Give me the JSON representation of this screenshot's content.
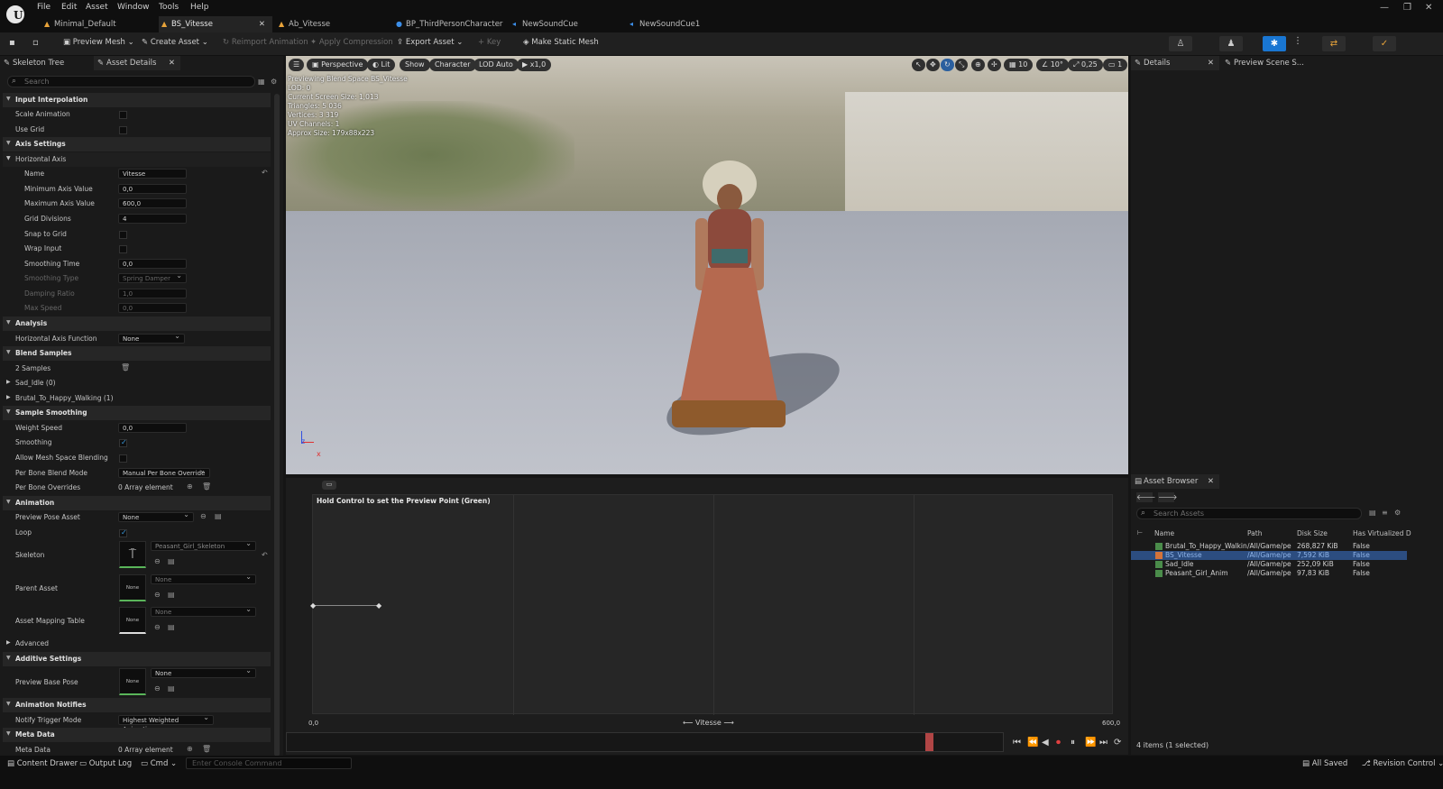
{
  "menu": [
    "File",
    "Edit",
    "Asset",
    "Window",
    "Tools",
    "Help"
  ],
  "tabs": [
    {
      "label": "Minimal_Default",
      "icon": "level-icon",
      "active": false
    },
    {
      "label": "BS_Vitesse",
      "icon": "blendspace-icon",
      "active": true
    },
    {
      "label": "Ab_Vitesse",
      "icon": "anim-icon",
      "active": false
    },
    {
      "label": "BP_ThirdPersonCharacter",
      "icon": "blueprint-icon",
      "active": false
    },
    {
      "label": "NewSoundCue",
      "icon": "sound-icon",
      "active": false
    },
    {
      "label": "NewSoundCue1",
      "icon": "sound-icon",
      "active": false
    }
  ],
  "toolbar": {
    "preview_mesh": "Preview Mesh",
    "create_asset": "Create Asset",
    "reimport": "Reimport Animation",
    "apply_compression": "Apply Compression",
    "export_asset": "Export Asset",
    "key": "Key",
    "make_static_mesh": "Make Static Mesh"
  },
  "left_tabs": {
    "skeleton_tree": "Skeleton Tree",
    "asset_details": "Asset Details"
  },
  "search_placeholder": "Search",
  "details": {
    "input_interpolation": "Input Interpolation",
    "scale_animation": "Scale Animation",
    "use_grid": "Use Grid",
    "axis_settings": "Axis Settings",
    "horizontal_axis": "Horizontal Axis",
    "name_label": "Name",
    "name_value": "Vitesse",
    "min_label": "Minimum Axis Value",
    "min_value": "0,0",
    "max_label": "Maximum Axis Value",
    "max_value": "600,0",
    "grid_div_label": "Grid Divisions",
    "grid_div_value": "4",
    "snap_label": "Snap to Grid",
    "wrap_label": "Wrap Input",
    "smoothing_time_label": "Smoothing Time",
    "smoothing_time_value": "0,0",
    "smoothing_type_label": "Smoothing Type",
    "smoothing_type_value": "Spring Damper",
    "damping_label": "Damping Ratio",
    "damping_value": "1,0",
    "maxspeed_label": "Max Speed",
    "maxspeed_value": "0,0",
    "analysis": "Analysis",
    "haf_label": "Horizontal Axis Function",
    "haf_value": "None",
    "blend_samples": "Blend Samples",
    "samples_count": "2 Samples",
    "sample0": "Sad_Idle (0)",
    "sample1": "Brutal_To_Happy_Walking (1)",
    "sample_smoothing": "Sample Smoothing",
    "weight_speed_label": "Weight Speed",
    "weight_speed_value": "0,0",
    "smoothing_label": "Smoothing",
    "allow_mesh_label": "Allow Mesh Space Blending",
    "per_bone_mode_label": "Per Bone Blend Mode",
    "per_bone_mode_value": "Manual Per Bone Override",
    "per_bone_over_label": "Per Bone Overrides",
    "per_bone_over_value": "0 Array element",
    "animation": "Animation",
    "preview_pose_label": "Preview Pose Asset",
    "preview_pose_value": "None",
    "loop_label": "Loop",
    "skeleton_label": "Skeleton",
    "skeleton_value": "Peasant_Girl_Skeleton",
    "parent_label": "Parent Asset",
    "parent_value": "None",
    "parent_thumb": "None",
    "mapping_label": "Asset Mapping Table",
    "mapping_value": "None",
    "mapping_thumb": "None",
    "advanced": "Advanced",
    "additive": "Additive Settings",
    "base_pose_label": "Preview Base Pose",
    "base_pose_value": "None",
    "base_pose_thumb": "None",
    "notifies": "Animation Notifies",
    "notify_mode_label": "Notify Trigger Mode",
    "notify_mode_value": "Highest Weighted Animation",
    "meta": "Meta Data",
    "meta_label": "Meta Data",
    "meta_value": "0 Array element"
  },
  "viewport": {
    "perspective": "Perspective",
    "lit": "Lit",
    "show": "Show",
    "character": "Character",
    "lod": "LOD Auto",
    "speed": "x1,0",
    "grid": "10",
    "angle": "10°",
    "scale": "0,25",
    "cam": "1",
    "stats": [
      "Previewing Blend Space BS_Vitesse",
      "LOD: 0",
      "Current Screen Size: 1,013",
      "Triangles: 5 036",
      "Vertices: 3 319",
      "UV Channels: 1",
      "Approx Size: 179x88x223"
    ]
  },
  "right_tabs": {
    "details": "Details",
    "preview_scene": "Preview Scene S..."
  },
  "blendspace": {
    "hint": "Hold Control to set the Preview Point (Green)",
    "min": "0,0",
    "max": "600,0",
    "axis": "Vitesse"
  },
  "asset_browser": {
    "title": "Asset Browser",
    "search_placeholder": "Search Assets",
    "columns": [
      "Name",
      "Path",
      "Disk Size",
      "Has Virtualized D"
    ],
    "rows": [
      {
        "name": "Brutal_To_Happy_Walkin",
        "path": "/All/Game/pe",
        "size": "268,827 KiB",
        "virt": "False"
      },
      {
        "name": "BS_Vitesse",
        "path": "/All/Game/pe",
        "size": "7,592 KiB",
        "virt": "False"
      },
      {
        "name": "Sad_Idle",
        "path": "/All/Game/pe",
        "size": "252,09 KiB",
        "virt": "False"
      },
      {
        "name": "Peasant_Girl_Anim",
        "path": "/All/Game/pe",
        "size": "97,83 KiB",
        "virt": "False"
      }
    ],
    "count": "4 items (1 selected)"
  },
  "statusbar": {
    "content_drawer": "Content Drawer",
    "output_log": "Output Log",
    "cmd": "Cmd",
    "console_placeholder": "Enter Console Command",
    "all_saved": "All Saved",
    "revision": "Revision Control"
  },
  "colors": {
    "accent": "#1976d2",
    "selected_row": "#2c4d80",
    "playhead": "#b04545"
  }
}
